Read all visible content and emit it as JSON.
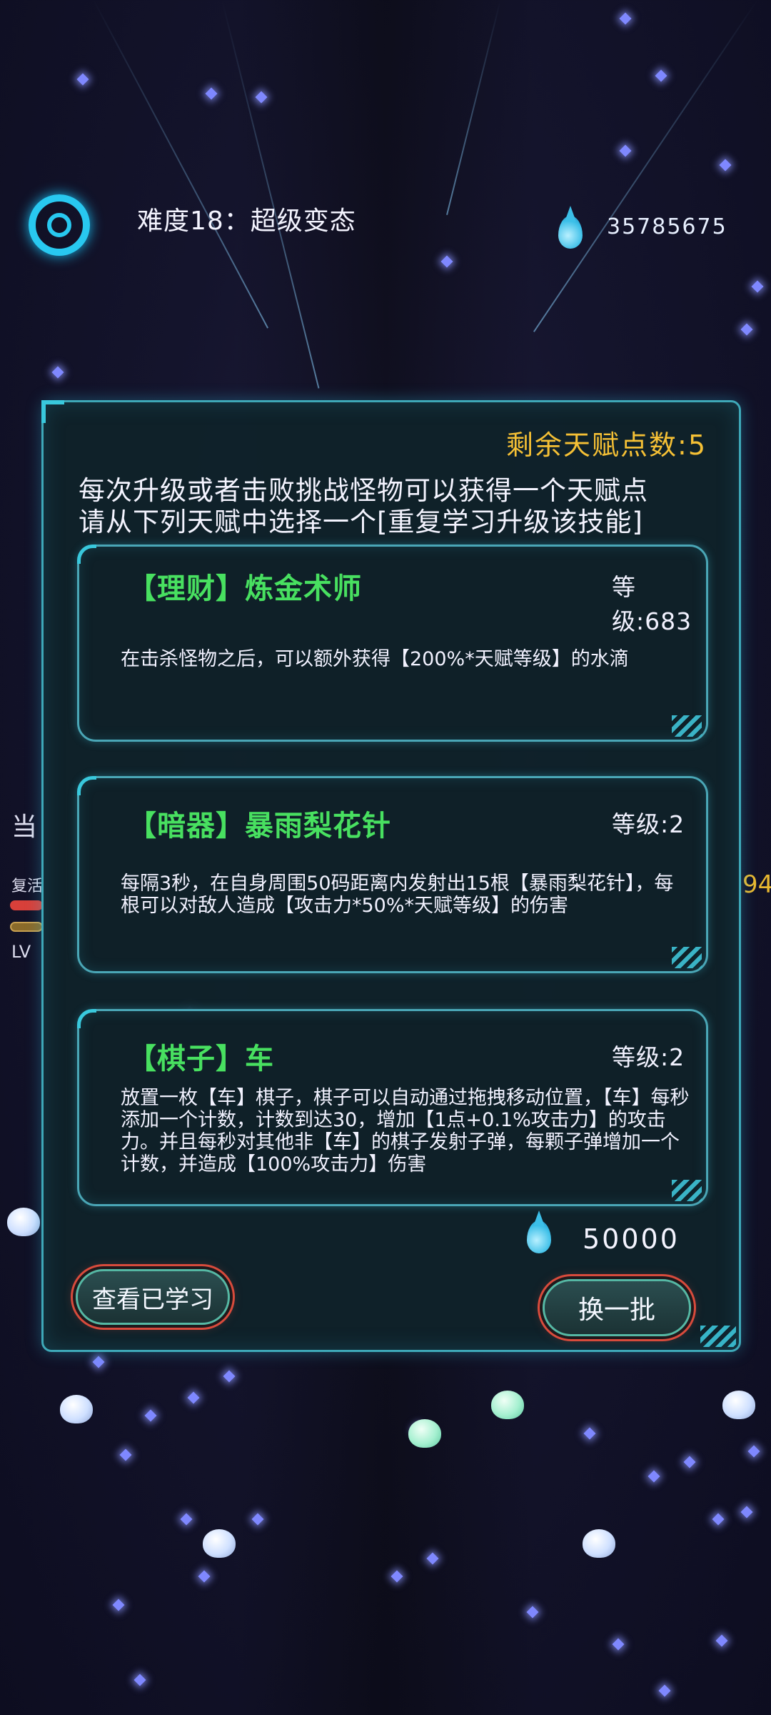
{
  "hud": {
    "difficulty": "难度18：超级变态",
    "currency": "35785675",
    "side_labels": {
      "dang": "当",
      "revive": "复活",
      "lv": "LV",
      "right_num": "94"
    }
  },
  "panel": {
    "talent_points": "剩余天赋点数:5",
    "desc_line1": "每次升级或者击败挑战怪物可以获得一个天赋点",
    "desc_line2": "请从下列天赋中选择一个[重复学习升级该技能]",
    "cards": [
      {
        "title": "【理财】炼金术师",
        "level": "等级:683",
        "description": "在击杀怪物之后，可以额外获得【200%*天赋等级】的水滴"
      },
      {
        "title": "【暗器】暴雨梨花针",
        "level": "等级:2",
        "description": "每隔3秒，在自身周围50码距离内发射出15根【暴雨梨花针】，每根可以对敌人造成【攻击力*50%*天赋等级】的伤害"
      },
      {
        "title": "【棋子】车",
        "level": "等级:2",
        "description": "放置一枚【车】棋子，棋子可以自动通过拖拽移动位置，【车】每秒添加一个计数，计数到达30，增加【1点+0.1%攻击力】的攻击力。并且每秒对其他非【车】的棋子发射子弹，每颗子弹增加一个计数，并造成【100%攻击力】伤害"
      }
    ],
    "refresh_cost": "50000",
    "learned_button": "查看已学习",
    "refresh_button": "换一批"
  },
  "colors": {
    "talent_points": "#f5c035",
    "card_title": "#48e060",
    "panel_border": "#3ea8b8",
    "button_glow": "#d84b3c"
  },
  "icons": [
    "target-ring-icon",
    "water-drop-icon"
  ]
}
